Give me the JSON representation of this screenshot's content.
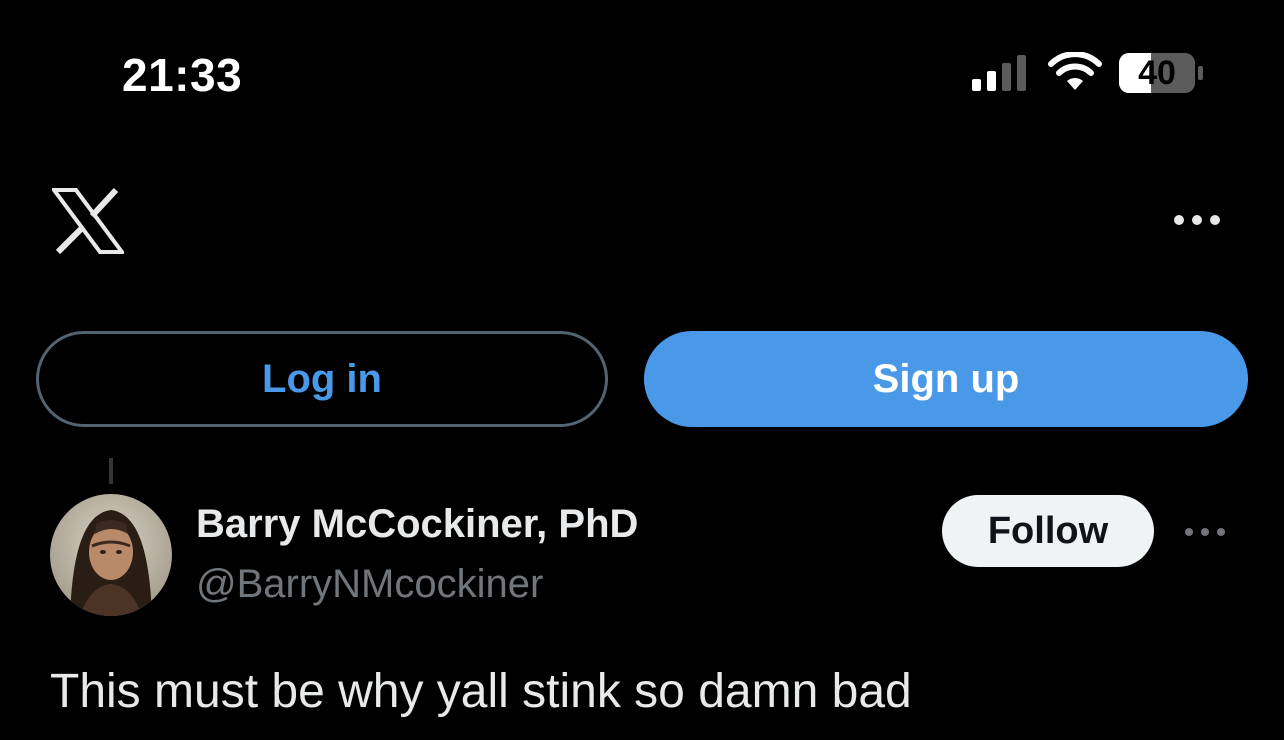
{
  "status_bar": {
    "time": "21:33",
    "battery": "40",
    "signal_icon": "cellular-signal-icon",
    "wifi_icon": "wifi-icon",
    "battery_icon": "battery-icon"
  },
  "header": {
    "logo_icon": "x-logo-icon",
    "more_icon": "more-horizontal-icon"
  },
  "auth": {
    "login_label": "Log in",
    "signup_label": "Sign up"
  },
  "tweet": {
    "author_name": "Barry McCockiner, PhD",
    "author_handle": "@BarryNMcockiner",
    "follow_label": "Follow",
    "text": "This must be why yall stink so damn bad",
    "more_icon": "more-horizontal-icon"
  },
  "colors": {
    "background": "#000000",
    "accent": "#4a99e9",
    "text_primary": "#e7e9ea",
    "text_secondary": "#71767b",
    "follow_bg": "#eff3f4"
  }
}
